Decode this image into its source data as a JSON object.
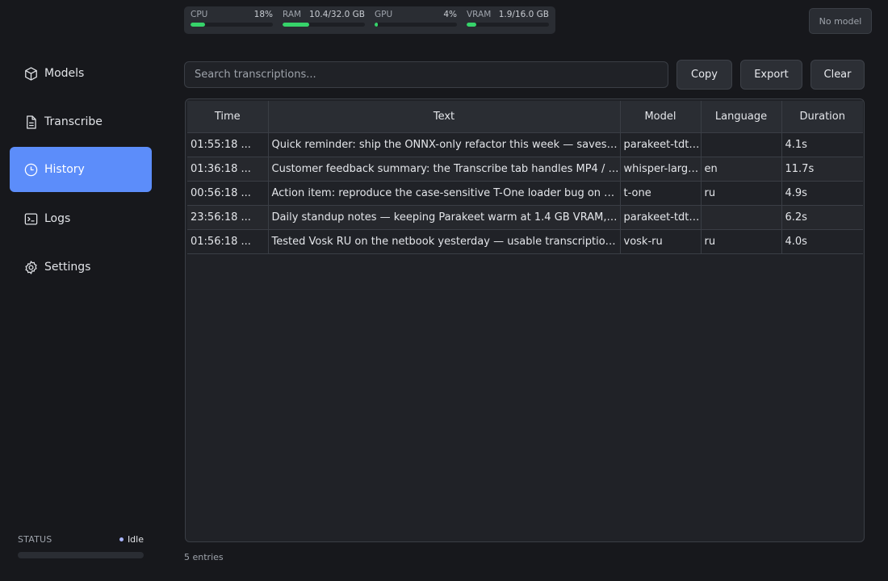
{
  "sidebar": {
    "items": [
      {
        "label": "Models",
        "icon": "cube-icon"
      },
      {
        "label": "Transcribe",
        "icon": "document-icon"
      },
      {
        "label": "History",
        "icon": "clock-icon",
        "active": true
      },
      {
        "label": "Logs",
        "icon": "terminal-icon"
      },
      {
        "label": "Settings",
        "icon": "gear-icon"
      }
    ],
    "status_label": "STATUS",
    "status_value": "Idle",
    "active_color": "#5c8dfa"
  },
  "metrics": [
    {
      "name": "CPU",
      "value": "18%",
      "fill": 0.18
    },
    {
      "name": "RAM",
      "value": "10.4/32.0 GB",
      "fill": 0.325
    },
    {
      "name": "GPU",
      "value": "4%",
      "fill": 0.04
    },
    {
      "name": "VRAM",
      "value": "1.9/16.0 GB",
      "fill": 0.12
    }
  ],
  "model_badge": "No model",
  "search": {
    "placeholder": "Search transcriptions...",
    "value": ""
  },
  "toolbar": {
    "copy_label": "Copy",
    "export_label": "Export",
    "clear_label": "Clear"
  },
  "table": {
    "headers": [
      "Time",
      "Text",
      "Model",
      "Language",
      "Duration"
    ],
    "rows": [
      {
        "time": "01:55:18 ...",
        "text": "Quick reminder: ship the ONNX-only refactor this week — saves us ...",
        "model": "parakeet-tdt-...",
        "language": "",
        "duration": "4.1s"
      },
      {
        "time": "01:36:18 ...",
        "text": "Customer feedback summary: the Transcribe tab handles MP4 / MKV...",
        "model": "whisper-large...",
        "language": "en",
        "duration": "11.7s"
      },
      {
        "time": "00:56:18 ...",
        "text": "Action item: reproduce the case-sensitive T-One loader bug on a ...",
        "model": "t-one",
        "language": "ru",
        "duration": "4.9s"
      },
      {
        "time": "23:56:18 ...",
        "text": "Daily standup notes — keeping Parakeet warm at 1.4 GB VRAM, ...",
        "model": "parakeet-tdt-...",
        "language": "",
        "duration": "6.2s"
      },
      {
        "time": "01:56:18 ...",
        "text": "Tested Vosk RU on the netbook yesterday — usable transcription on ...",
        "model": "vosk-ru",
        "language": "ru",
        "duration": "4.0s"
      }
    ]
  },
  "footer": {
    "entries": "5 entries"
  }
}
